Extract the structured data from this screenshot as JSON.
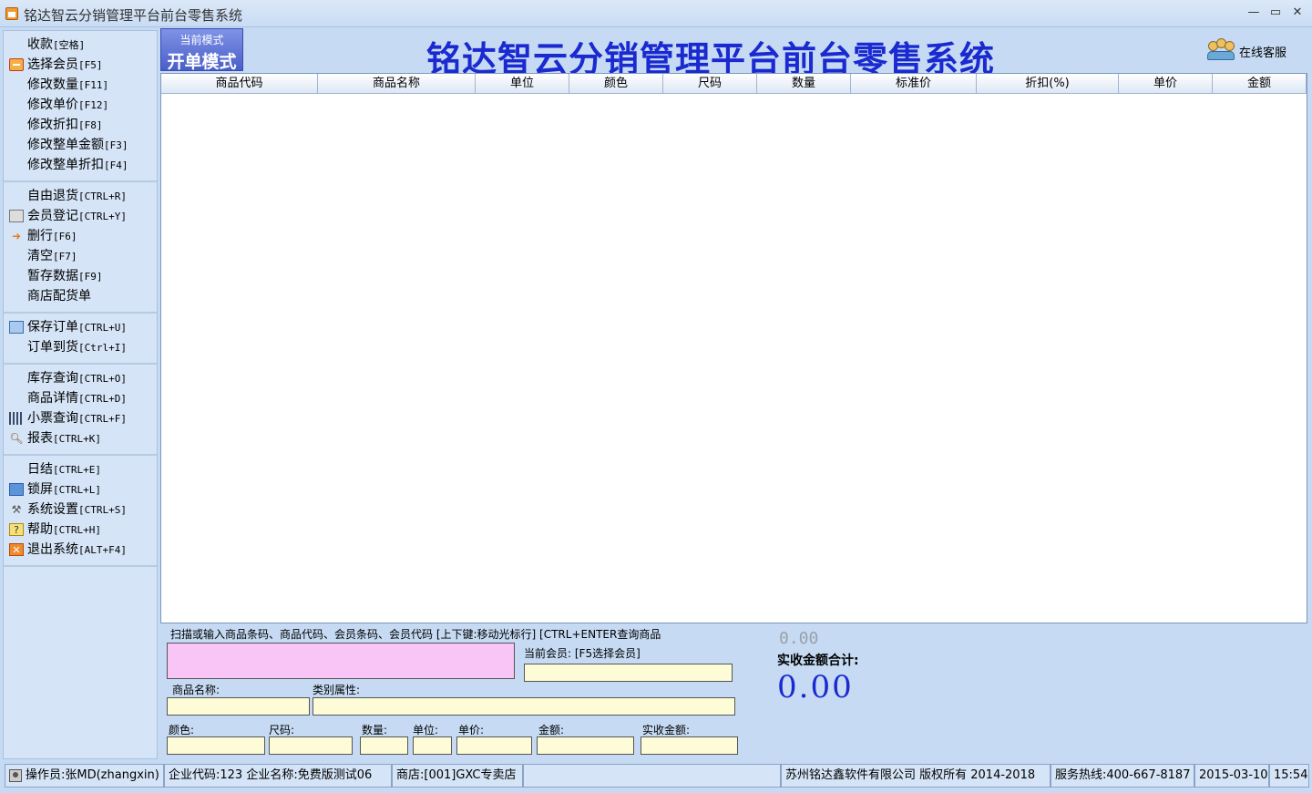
{
  "window": {
    "title": "铭达智云分销管理平台前台零售系统",
    "minimize": "—",
    "maximize": "▭",
    "close": "✕"
  },
  "sidebar": {
    "groups": [
      [
        {
          "label": "收款",
          "key": "[空格]",
          "icon": ""
        },
        {
          "label": "选择会员",
          "key": "[F5]",
          "icon": "member-card-icon"
        },
        {
          "label": "修改数量",
          "key": "[F11]",
          "icon": ""
        },
        {
          "label": "修改单价",
          "key": "[F12]",
          "icon": ""
        },
        {
          "label": "修改折扣",
          "key": "[F8]",
          "icon": ""
        },
        {
          "label": "修改整单金额",
          "key": "[F3]",
          "icon": ""
        },
        {
          "label": "修改整单折扣",
          "key": "[F4]",
          "icon": ""
        }
      ],
      [
        {
          "label": "自由退货",
          "key": "[CTRL+R]",
          "icon": ""
        },
        {
          "label": "会员登记",
          "key": "[CTRL+Y]",
          "icon": "id-card-icon"
        },
        {
          "label": "删行",
          "key": "[F6]",
          "icon": "arrow-right-icon"
        },
        {
          "label": "清空",
          "key": "[F7]",
          "icon": ""
        },
        {
          "label": "暂存数据",
          "key": "[F9]",
          "icon": ""
        },
        {
          "label": "商店配货单",
          "key": "",
          "icon": ""
        }
      ],
      [
        {
          "label": "保存订单",
          "key": "[CTRL+U]",
          "icon": "save-icon"
        },
        {
          "label": "订单到货",
          "key": "[Ctrl+I]",
          "icon": ""
        }
      ],
      [
        {
          "label": "库存查询",
          "key": "[CTRL+O]",
          "icon": ""
        },
        {
          "label": "商品详情",
          "key": "[CTRL+D]",
          "icon": ""
        },
        {
          "label": "小票查询",
          "key": "[CTRL+F]",
          "icon": "barcode-icon"
        },
        {
          "label": "报表",
          "key": "[CTRL+K]",
          "icon": "magnifier-icon"
        }
      ],
      [
        {
          "label": "日结",
          "key": "[CTRL+E]",
          "icon": ""
        },
        {
          "label": "锁屏",
          "key": "[CTRL+L]",
          "icon": "monitor-icon"
        },
        {
          "label": "系统设置",
          "key": "[CTRL+S]",
          "icon": "tools-icon"
        },
        {
          "label": "帮助",
          "key": "[CTRL+H]",
          "icon": "help-icon"
        },
        {
          "label": "退出系统",
          "key": "[ALT+F4]",
          "icon": "exit-icon"
        }
      ]
    ]
  },
  "header": {
    "mode_small": "当前模式",
    "mode_big": "开单模式",
    "title": "铭达智云分销管理平台前台零售系统",
    "online_service": "在线客服"
  },
  "table": {
    "columns": [
      "商品代码",
      "商品名称",
      "单位",
      "颜色",
      "尺码",
      "数量",
      "标准价",
      "折扣(%)",
      "单价",
      "金额"
    ],
    "rows": []
  },
  "input": {
    "scan_hint": "扫描或输入商品条码、商品代码、会员条码、会员代码 [上下键:移动光标行] [CTRL+ENTER查询商品",
    "current_member_label": "当前会员: [F5选择会员]",
    "product_name_label": "商品名称:",
    "category_label": "类别属性:",
    "color_label": "颜色:",
    "size_label": "尺码:",
    "qty_label": "数量:",
    "unit_label": "单位:",
    "price_label": "单价:",
    "amount_label": "金额:",
    "actual_amount_label": "实收金额:"
  },
  "summary": {
    "small_value": "0.00",
    "label": "实收金额合计:",
    "big_value": "0.00"
  },
  "status": {
    "operator": "操作员:张MD(zhangxin)",
    "company": "企业代码:123 企业名称:免费版测试06",
    "store": "商店:[001]GXC专卖店",
    "blank": "",
    "copyright": "苏州铭达鑫软件有限公司 版权所有 2014-2018",
    "hotline": "服务热线:400-667-8187",
    "date": "2015-03-10",
    "time": "15:54"
  }
}
